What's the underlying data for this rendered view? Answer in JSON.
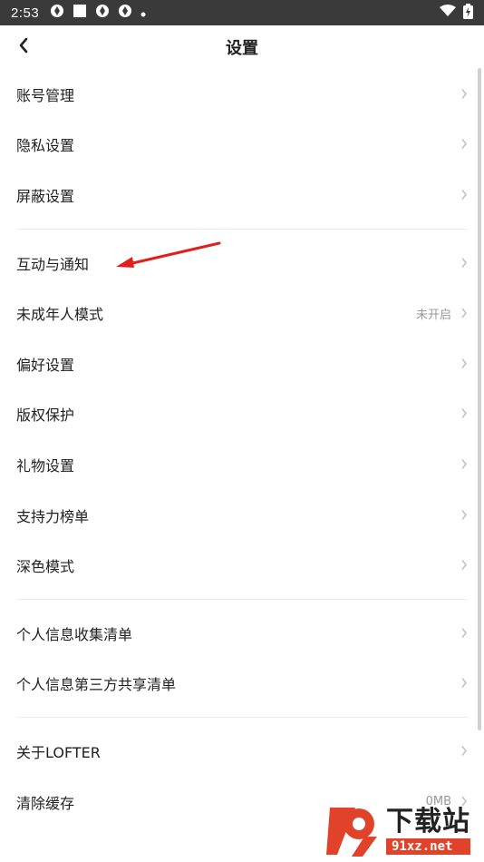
{
  "status_bar": {
    "time": "2:53",
    "icons": [
      "aperture-icon",
      "square-icon",
      "aperture-icon",
      "aperture-icon",
      "dot-icon"
    ],
    "right_icons": [
      "wifi-icon",
      "battery-icon"
    ]
  },
  "header": {
    "title": "设置",
    "back_icon": "chevron-left-icon"
  },
  "settings": {
    "group1": [
      {
        "label": "账号管理"
      },
      {
        "label": "隐私设置"
      },
      {
        "label": "屏蔽设置"
      }
    ],
    "group2": [
      {
        "label": "互动与通知"
      },
      {
        "label": "未成年人模式",
        "value": "未开启"
      },
      {
        "label": "偏好设置"
      },
      {
        "label": "版权保护"
      },
      {
        "label": "礼物设置"
      },
      {
        "label": "支持力榜单"
      },
      {
        "label": "深色模式"
      }
    ],
    "group3": [
      {
        "label": "个人信息收集清单"
      },
      {
        "label": "个人信息第三方共享清单"
      }
    ],
    "group4": [
      {
        "label": "关于LOFTER"
      },
      {
        "label": "清除缓存",
        "value": "0MB"
      }
    ]
  },
  "annotation": {
    "arrow_color": "#e0201c"
  },
  "watermark": {
    "main": "下载站",
    "sub": "91xz.net",
    "accent": "#e0432a"
  }
}
